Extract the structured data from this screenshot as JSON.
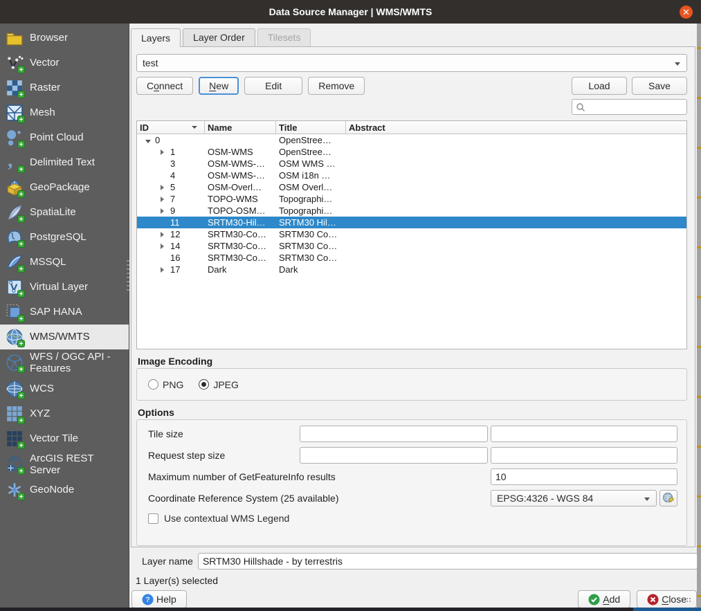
{
  "window": {
    "title": "Data Source Manager | WMS/WMTS",
    "close_glyph": "✕"
  },
  "colors": {
    "titlebar": "#332f2d",
    "close_button": "#e95420",
    "sidebar_bg": "#5d5d5d",
    "sidebar_selected_bg": "#e9e9e9",
    "selection_blue": "#2e88c9",
    "add_green": "#2e9e49",
    "close_red": "#b4232a",
    "help_blue": "#3584e4"
  },
  "sidebar": {
    "items": [
      {
        "label": "Browser",
        "icon": "folder-icon",
        "plus": false,
        "selected": false
      },
      {
        "label": "Vector",
        "icon": "vector-icon",
        "plus": true,
        "selected": false
      },
      {
        "label": "Raster",
        "icon": "raster-icon",
        "plus": true,
        "selected": false
      },
      {
        "label": "Mesh",
        "icon": "mesh-icon",
        "plus": true,
        "selected": false
      },
      {
        "label": "Point Cloud",
        "icon": "point-cloud-icon",
        "plus": true,
        "selected": false
      },
      {
        "label": "Delimited Text",
        "icon": "delimited-text-icon",
        "plus": true,
        "selected": false
      },
      {
        "label": "GeoPackage",
        "icon": "geopackage-icon",
        "plus": true,
        "selected": false
      },
      {
        "label": "SpatiaLite",
        "icon": "spatialite-icon",
        "plus": true,
        "selected": false
      },
      {
        "label": "PostgreSQL",
        "icon": "postgresql-icon",
        "plus": true,
        "selected": false
      },
      {
        "label": "MSSQL",
        "icon": "mssql-icon",
        "plus": true,
        "selected": false
      },
      {
        "label": "Virtual Layer",
        "icon": "virtual-layer-icon",
        "plus": true,
        "selected": false
      },
      {
        "label": "SAP HANA",
        "icon": "sap-hana-icon",
        "plus": true,
        "selected": false
      },
      {
        "label": "WMS/WMTS",
        "icon": "wms-icon",
        "plus": true,
        "selected": true
      },
      {
        "label": "WFS / OGC API - Features",
        "icon": "wfs-icon",
        "plus": true,
        "selected": false
      },
      {
        "label": "WCS",
        "icon": "wcs-icon",
        "plus": true,
        "selected": false
      },
      {
        "label": "XYZ",
        "icon": "xyz-icon",
        "plus": true,
        "selected": false
      },
      {
        "label": "Vector Tile",
        "icon": "vector-tile-icon",
        "plus": true,
        "selected": false
      },
      {
        "label": "ArcGIS REST Server",
        "icon": "arcgis-icon",
        "plus": true,
        "selected": false
      },
      {
        "label": "GeoNode",
        "icon": "geonode-icon",
        "plus": true,
        "selected": false
      }
    ]
  },
  "tabs": [
    {
      "label": "Layers",
      "active": true,
      "disabled": false
    },
    {
      "label": "Layer Order",
      "active": false,
      "disabled": false
    },
    {
      "label": "Tilesets",
      "active": false,
      "disabled": true
    }
  ],
  "connection": {
    "value": "test",
    "connect": {
      "label": "Connect",
      "mnemonic": "o"
    },
    "new": {
      "label": "New",
      "mnemonic": "N"
    },
    "edit": {
      "label": "Edit",
      "mnemonic": ""
    },
    "remove": {
      "label": "Remove",
      "mnemonic": ""
    },
    "load": {
      "label": "Load",
      "mnemonic": ""
    },
    "save": {
      "label": "Save",
      "mnemonic": ""
    }
  },
  "search": {
    "placeholder": "",
    "icon": "search-icon"
  },
  "layers_table": {
    "columns": [
      "ID",
      "Name",
      "Title",
      "Abstract"
    ],
    "sorted_column": "ID",
    "rows": [
      {
        "id": "0",
        "name": "",
        "title": "OpenStree…",
        "abstract": "",
        "depth": 0,
        "expander": "expanded",
        "selected": false
      },
      {
        "id": "1",
        "name": "OSM-WMS",
        "title": "OpenStree…",
        "abstract": "",
        "depth": 1,
        "expander": "collapsed",
        "selected": false
      },
      {
        "id": "3",
        "name": "OSM-WMS-…",
        "title": "OSM WMS …",
        "abstract": "",
        "depth": 1,
        "expander": "none",
        "selected": false
      },
      {
        "id": "4",
        "name": "OSM-WMS-…",
        "title": "OSM i18n …",
        "abstract": "",
        "depth": 1,
        "expander": "none",
        "selected": false
      },
      {
        "id": "5",
        "name": "OSM-Overl…",
        "title": "OSM Overl…",
        "abstract": "",
        "depth": 1,
        "expander": "collapsed",
        "selected": false
      },
      {
        "id": "7",
        "name": "TOPO-WMS",
        "title": "Topographi…",
        "abstract": "",
        "depth": 1,
        "expander": "collapsed",
        "selected": false
      },
      {
        "id": "9",
        "name": "TOPO-OSM…",
        "title": "Topographi…",
        "abstract": "",
        "depth": 1,
        "expander": "collapsed",
        "selected": false
      },
      {
        "id": "11",
        "name": "SRTM30-Hil…",
        "title": "SRTM30 Hil…",
        "abstract": "",
        "depth": 1,
        "expander": "none",
        "selected": true
      },
      {
        "id": "12",
        "name": "SRTM30-Co…",
        "title": "SRTM30 Co…",
        "abstract": "",
        "depth": 1,
        "expander": "collapsed",
        "selected": false
      },
      {
        "id": "14",
        "name": "SRTM30-Co…",
        "title": "SRTM30 Co…",
        "abstract": "",
        "depth": 1,
        "expander": "collapsed",
        "selected": false
      },
      {
        "id": "16",
        "name": "SRTM30-Co…",
        "title": "SRTM30 Co…",
        "abstract": "",
        "depth": 1,
        "expander": "none",
        "selected": false
      },
      {
        "id": "17",
        "name": "Dark",
        "title": "Dark",
        "abstract": "",
        "depth": 1,
        "expander": "collapsed",
        "selected": false
      }
    ]
  },
  "image_encoding": {
    "title": "Image Encoding",
    "options": [
      {
        "label": "PNG",
        "selected": false
      },
      {
        "label": "JPEG",
        "selected": true
      }
    ]
  },
  "options": {
    "title": "Options",
    "tile_size_label": "Tile size",
    "tile_size_values": [
      "",
      ""
    ],
    "request_step_label": "Request step size",
    "request_step_values": [
      "",
      ""
    ],
    "max_gfi_label": "Maximum number of GetFeatureInfo results",
    "max_gfi_value": "10",
    "crs_label": "Coordinate Reference System (25 available)",
    "crs_value": "EPSG:4326 - WGS 84",
    "crs_button_icon": "crs-globe-icon",
    "legend_label": "Use contextual WMS Legend",
    "legend_checked": false
  },
  "footer": {
    "layer_name_label": "Layer name",
    "layer_name_value": "SRTM30 Hillshade - by terrestris",
    "status": "1 Layer(s) selected",
    "help": {
      "label": "Help",
      "mnemonic": "",
      "icon": "help-icon"
    },
    "add": {
      "label": "Add",
      "mnemonic": "A",
      "icon": "add-icon"
    },
    "close": {
      "label": "Close",
      "mnemonic": "C",
      "icon": "close-icon"
    }
  }
}
